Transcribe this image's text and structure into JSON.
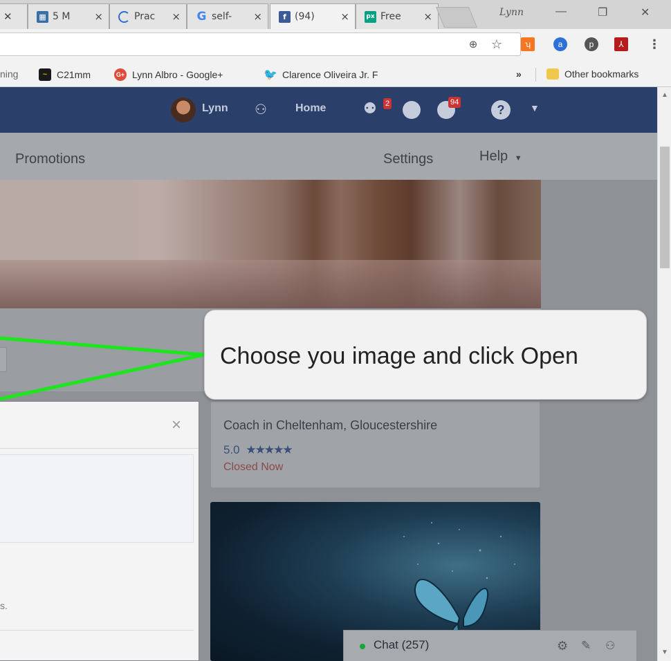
{
  "browser": {
    "tabs": [
      {
        "label": "5 M",
        "icon": "tab-video-icon",
        "color": "#3b6ea5"
      },
      {
        "label": "Prac",
        "icon": "tab-loading-icon",
        "color": "#2b6fd6"
      },
      {
        "label": "self-",
        "icon": "google-icon",
        "color": "#4285f4"
      },
      {
        "label": "(94)",
        "icon": "facebook-icon",
        "color": "#3b5998"
      },
      {
        "label": "Free",
        "icon": "pexels-icon",
        "color": "#05a081"
      }
    ],
    "tab_close": "×",
    "profile_name": "Lynn",
    "window_buttons": {
      "minimize": "—",
      "restore": "❐",
      "close": "✕"
    }
  },
  "toolbar": {
    "icons": [
      "zoom-icon",
      "bookmark-star-icon",
      "hubspot-icon",
      "extension-a-icon",
      "pinterest-icon",
      "acrobat-icon",
      "menu-icon"
    ]
  },
  "bookmarks": {
    "items": [
      {
        "label": "ning",
        "icon": ""
      },
      {
        "label": "C21mm",
        "icon": "c21-icon",
        "color": "#1a1a1a"
      },
      {
        "label": "Lynn Albro - Google+",
        "icon": "google-plus-icon",
        "color": "#dd4b39"
      },
      {
        "label": "Clarence Oliveira Jr. F",
        "icon": "twitter-icon",
        "color": "#1da1f2"
      }
    ],
    "overflow": "»",
    "other": "Other bookmarks"
  },
  "facebook": {
    "user": "Lynn",
    "home": "Home",
    "friend_requests": "2",
    "notifications": "94",
    "subnav": {
      "promotions": "Promotions",
      "settings": "Settings",
      "help": "Help"
    },
    "info_card": {
      "category": "Coach in Cheltenham, Gloucestershire",
      "rating": "5.0",
      "stars": 5,
      "status": "Closed Now"
    },
    "dialog": {
      "close": "×",
      "text_fragment": "s."
    },
    "chat": {
      "label": "Chat (257)"
    }
  },
  "callout": {
    "text": "Choose you image and click Open",
    "arrow_color": "#1ee61e"
  },
  "colors": {
    "fb_blue": "#2b3f6b",
    "overlay": "#8e9196",
    "arrow_green": "#1ee61e"
  }
}
